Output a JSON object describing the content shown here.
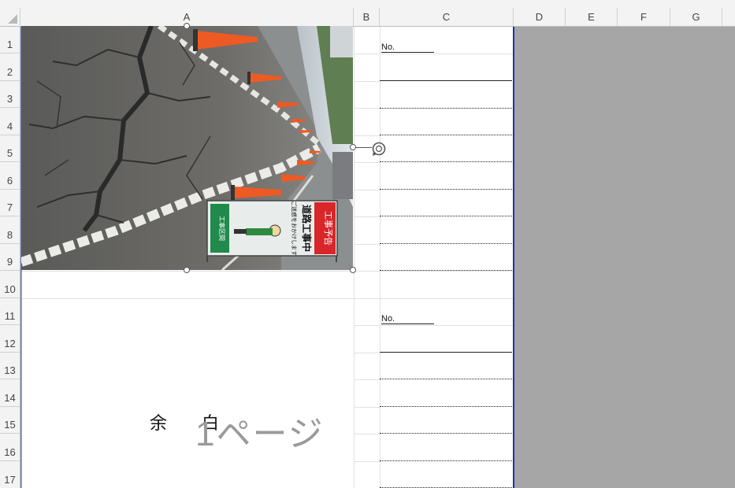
{
  "columns": [
    "A",
    "B",
    "C",
    "D",
    "E",
    "F",
    "G"
  ],
  "rows": [
    "1",
    "2",
    "3",
    "4",
    "5",
    "6",
    "7",
    "8",
    "9",
    "10",
    "11",
    "12",
    "13",
    "14",
    "15",
    "16",
    "17"
  ],
  "cells": {
    "c1_no": "No.",
    "c11_no": "No.",
    "a15_text": "余　　白"
  },
  "watermark": "1ページ",
  "photo": {
    "sign_top": "工事予告",
    "sign_main": "道路工事中",
    "sign_sub": "ご迷惑をおかけします",
    "sign_arrow": "工事区間"
  },
  "colors": {
    "page_border": "#1f2fb0",
    "outside_print_area": "#a6a6a6",
    "header_bg": "#f3f3f3"
  }
}
